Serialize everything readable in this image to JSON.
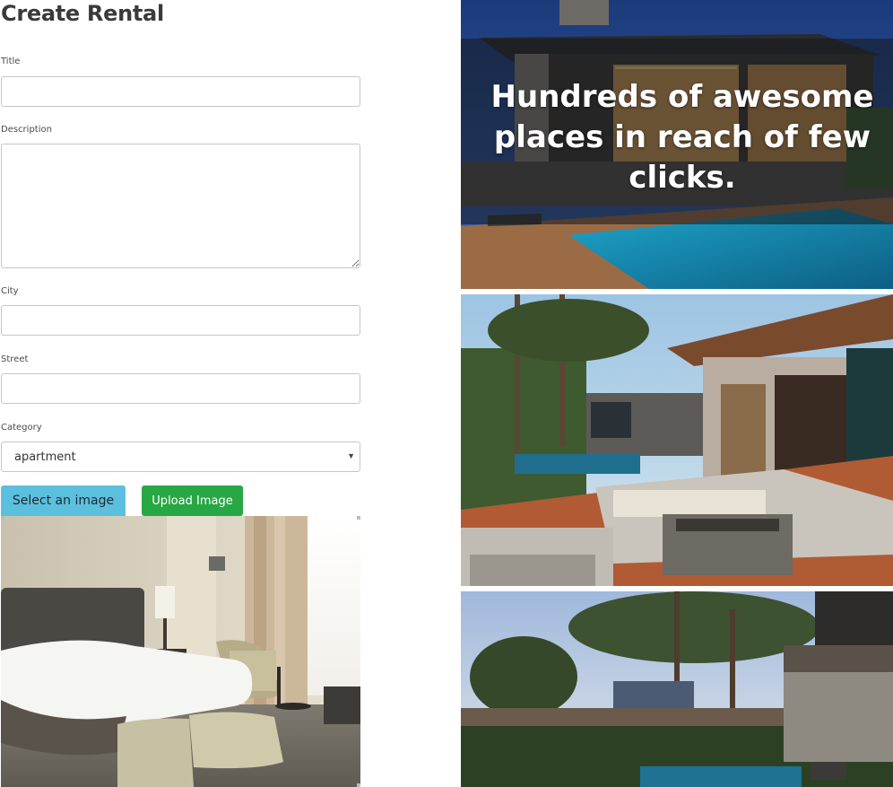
{
  "form": {
    "title": "Create Rental",
    "labels": {
      "title": "Title",
      "description": "Description",
      "city": "City",
      "street": "Street",
      "category": "Category"
    },
    "values": {
      "title": "",
      "description": "",
      "city": "",
      "street": ""
    },
    "category": {
      "selected": "apartment"
    },
    "buttons": {
      "select_image": "Select an image",
      "upload_image": "Upload Image"
    }
  },
  "hero": {
    "headline": "Hundreds of awesome places in reach of few clicks."
  },
  "colors": {
    "info_button": "#5bc0de",
    "success_button": "#28a745",
    "title_text": "#3a3a3a",
    "hero_overlay": "rgba(20,24,30,0.55)"
  },
  "icons": {
    "select_caret": "caret-down-icon"
  }
}
